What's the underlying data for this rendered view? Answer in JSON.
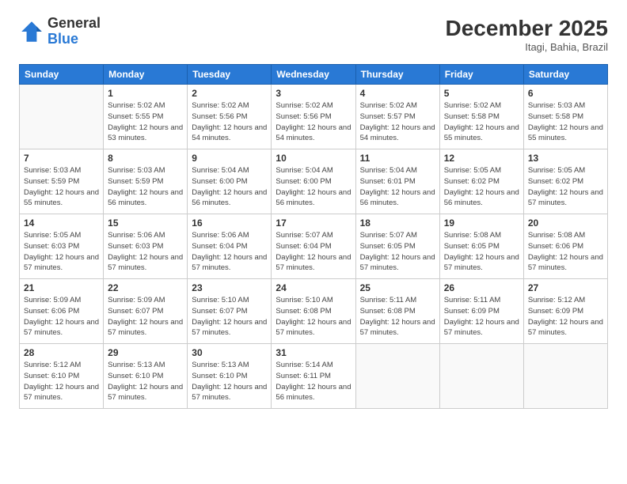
{
  "header": {
    "logo": {
      "general": "General",
      "blue": "Blue"
    },
    "title": "December 2025",
    "location": "Itagi, Bahia, Brazil"
  },
  "weekdays": [
    "Sunday",
    "Monday",
    "Tuesday",
    "Wednesday",
    "Thursday",
    "Friday",
    "Saturday"
  ],
  "weeks": [
    [
      {
        "day": "",
        "empty": true
      },
      {
        "day": "1",
        "sunrise": "5:02 AM",
        "sunset": "5:55 PM",
        "daylight": "12 hours and 53 minutes."
      },
      {
        "day": "2",
        "sunrise": "5:02 AM",
        "sunset": "5:56 PM",
        "daylight": "12 hours and 54 minutes."
      },
      {
        "day": "3",
        "sunrise": "5:02 AM",
        "sunset": "5:56 PM",
        "daylight": "12 hours and 54 minutes."
      },
      {
        "day": "4",
        "sunrise": "5:02 AM",
        "sunset": "5:57 PM",
        "daylight": "12 hours and 54 minutes."
      },
      {
        "day": "5",
        "sunrise": "5:02 AM",
        "sunset": "5:58 PM",
        "daylight": "12 hours and 55 minutes."
      },
      {
        "day": "6",
        "sunrise": "5:03 AM",
        "sunset": "5:58 PM",
        "daylight": "12 hours and 55 minutes."
      }
    ],
    [
      {
        "day": "7",
        "sunrise": "5:03 AM",
        "sunset": "5:59 PM",
        "daylight": "12 hours and 55 minutes."
      },
      {
        "day": "8",
        "sunrise": "5:03 AM",
        "sunset": "5:59 PM",
        "daylight": "12 hours and 56 minutes."
      },
      {
        "day": "9",
        "sunrise": "5:04 AM",
        "sunset": "6:00 PM",
        "daylight": "12 hours and 56 minutes."
      },
      {
        "day": "10",
        "sunrise": "5:04 AM",
        "sunset": "6:00 PM",
        "daylight": "12 hours and 56 minutes."
      },
      {
        "day": "11",
        "sunrise": "5:04 AM",
        "sunset": "6:01 PM",
        "daylight": "12 hours and 56 minutes."
      },
      {
        "day": "12",
        "sunrise": "5:05 AM",
        "sunset": "6:02 PM",
        "daylight": "12 hours and 56 minutes."
      },
      {
        "day": "13",
        "sunrise": "5:05 AM",
        "sunset": "6:02 PM",
        "daylight": "12 hours and 57 minutes."
      }
    ],
    [
      {
        "day": "14",
        "sunrise": "5:05 AM",
        "sunset": "6:03 PM",
        "daylight": "12 hours and 57 minutes."
      },
      {
        "day": "15",
        "sunrise": "5:06 AM",
        "sunset": "6:03 PM",
        "daylight": "12 hours and 57 minutes."
      },
      {
        "day": "16",
        "sunrise": "5:06 AM",
        "sunset": "6:04 PM",
        "daylight": "12 hours and 57 minutes."
      },
      {
        "day": "17",
        "sunrise": "5:07 AM",
        "sunset": "6:04 PM",
        "daylight": "12 hours and 57 minutes."
      },
      {
        "day": "18",
        "sunrise": "5:07 AM",
        "sunset": "6:05 PM",
        "daylight": "12 hours and 57 minutes."
      },
      {
        "day": "19",
        "sunrise": "5:08 AM",
        "sunset": "6:05 PM",
        "daylight": "12 hours and 57 minutes."
      },
      {
        "day": "20",
        "sunrise": "5:08 AM",
        "sunset": "6:06 PM",
        "daylight": "12 hours and 57 minutes."
      }
    ],
    [
      {
        "day": "21",
        "sunrise": "5:09 AM",
        "sunset": "6:06 PM",
        "daylight": "12 hours and 57 minutes."
      },
      {
        "day": "22",
        "sunrise": "5:09 AM",
        "sunset": "6:07 PM",
        "daylight": "12 hours and 57 minutes."
      },
      {
        "day": "23",
        "sunrise": "5:10 AM",
        "sunset": "6:07 PM",
        "daylight": "12 hours and 57 minutes."
      },
      {
        "day": "24",
        "sunrise": "5:10 AM",
        "sunset": "6:08 PM",
        "daylight": "12 hours and 57 minutes."
      },
      {
        "day": "25",
        "sunrise": "5:11 AM",
        "sunset": "6:08 PM",
        "daylight": "12 hours and 57 minutes."
      },
      {
        "day": "26",
        "sunrise": "5:11 AM",
        "sunset": "6:09 PM",
        "daylight": "12 hours and 57 minutes."
      },
      {
        "day": "27",
        "sunrise": "5:12 AM",
        "sunset": "6:09 PM",
        "daylight": "12 hours and 57 minutes."
      }
    ],
    [
      {
        "day": "28",
        "sunrise": "5:12 AM",
        "sunset": "6:10 PM",
        "daylight": "12 hours and 57 minutes."
      },
      {
        "day": "29",
        "sunrise": "5:13 AM",
        "sunset": "6:10 PM",
        "daylight": "12 hours and 57 minutes."
      },
      {
        "day": "30",
        "sunrise": "5:13 AM",
        "sunset": "6:10 PM",
        "daylight": "12 hours and 57 minutes."
      },
      {
        "day": "31",
        "sunrise": "5:14 AM",
        "sunset": "6:11 PM",
        "daylight": "12 hours and 56 minutes."
      },
      {
        "day": "",
        "empty": true
      },
      {
        "day": "",
        "empty": true
      },
      {
        "day": "",
        "empty": true
      }
    ]
  ]
}
